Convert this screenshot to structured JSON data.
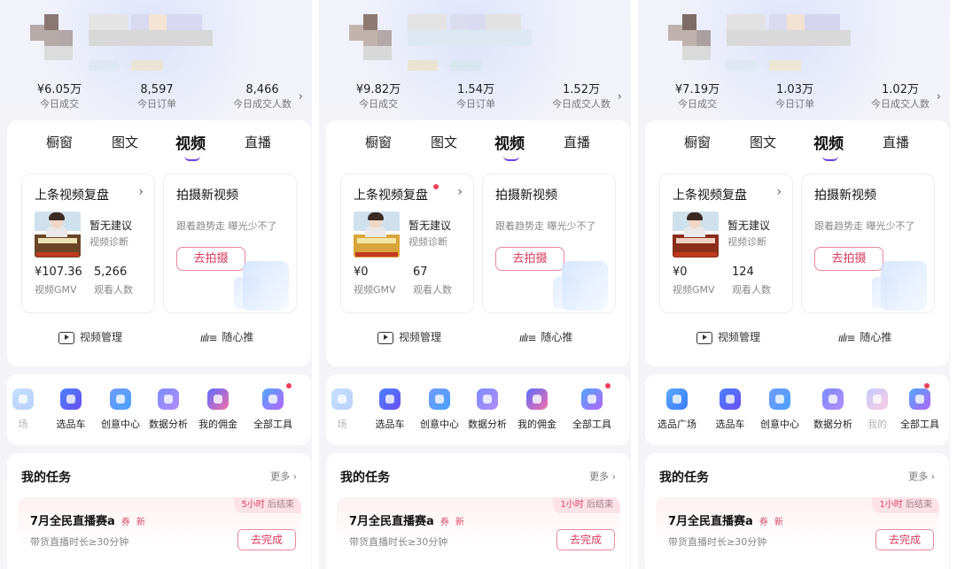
{
  "colors": {
    "accent": "#6b3fe0",
    "brand_red": "#d93a5c",
    "dot": "#f2405d"
  },
  "panels": [
    {
      "stats": [
        {
          "value": "¥6.05万",
          "label": "今日成交"
        },
        {
          "value": "8,597",
          "label": "今日订单"
        },
        {
          "value": "8,466",
          "label": "今日成交人数"
        }
      ],
      "tabs": [
        "橱窗",
        "图文",
        "视频",
        "直播"
      ],
      "active_tab": "视频",
      "review": {
        "title": "上条视频复盘",
        "has_dot": false,
        "suggest": "暂无建议",
        "diagnose": "视频诊断",
        "gmv_value": "¥107.36",
        "gmv_label": "视频GMV",
        "viewers_value": "5,266",
        "viewers_label": "观看人数"
      },
      "shoot": {
        "title": "拍摄新视频",
        "desc": "跟着趋势走 曝光少不了",
        "button": "去拍摄"
      },
      "footer": {
        "manage": "视频管理",
        "recommend": "随心推"
      },
      "tools": [
        "场",
        "选品车",
        "创意中心",
        "数据分析",
        "我的佣金",
        "全部工具"
      ],
      "task": {
        "title": "我的任务",
        "more": "更多",
        "name": "7月全民直播赛a",
        "tag1": "券",
        "tag2": "新",
        "remaining": "5小时",
        "ends": "后结束",
        "requirement": "带货直播时长≥30分钟",
        "button": "去完成"
      }
    },
    {
      "stats": [
        {
          "value": "¥9.82万",
          "label": "今日成交"
        },
        {
          "value": "1.54万",
          "label": "今日订单"
        },
        {
          "value": "1.52万",
          "label": "今日成交人数"
        }
      ],
      "tabs": [
        "橱窗",
        "图文",
        "视频",
        "直播"
      ],
      "active_tab": "视频",
      "review": {
        "title": "上条视频复盘",
        "has_dot": true,
        "suggest": "暂无建议",
        "diagnose": "视频诊断",
        "gmv_value": "¥0",
        "gmv_label": "视频GMV",
        "viewers_value": "67",
        "viewers_label": "观看人数"
      },
      "shoot": {
        "title": "拍摄新视频",
        "desc": "跟着趋势走 曝光少不了",
        "button": "去拍摄"
      },
      "footer": {
        "manage": "视频管理",
        "recommend": "随心推"
      },
      "tools": [
        "场",
        "选品车",
        "创意中心",
        "数据分析",
        "我的佣金",
        "全部工具"
      ],
      "task": {
        "title": "我的任务",
        "more": "更多",
        "name": "7月全民直播赛a",
        "tag1": "券",
        "tag2": "新",
        "remaining": "1小时",
        "ends": "后结束",
        "requirement": "带货直播时长≥30分钟",
        "button": "去完成"
      }
    },
    {
      "stats": [
        {
          "value": "¥7.19万",
          "label": "今日成交"
        },
        {
          "value": "1.03万",
          "label": "今日订单"
        },
        {
          "value": "1.02万",
          "label": "今日成交人数"
        }
      ],
      "tabs": [
        "橱窗",
        "图文",
        "视频",
        "直播"
      ],
      "active_tab": "视频",
      "review": {
        "title": "上条视频复盘",
        "has_dot": false,
        "suggest": "暂无建议",
        "diagnose": "视频诊断",
        "gmv_value": "¥0",
        "gmv_label": "视频GMV",
        "viewers_value": "124",
        "viewers_label": "观看人数"
      },
      "shoot": {
        "title": "拍摄新视频",
        "desc": "跟着趋势走 曝光少不了",
        "button": "去拍摄"
      },
      "footer": {
        "manage": "视频管理",
        "recommend": "随心推"
      },
      "tools": [
        "选品广场",
        "选品车",
        "创意中心",
        "数据分析",
        "我的",
        "全部工具"
      ],
      "task": {
        "title": "我的任务",
        "more": "更多",
        "name": "7月全民直播赛a",
        "tag1": "券",
        "tag2": "新",
        "remaining": "1小时",
        "ends": "后结束",
        "requirement": "带货直播时长≥30分钟",
        "button": "去完成"
      }
    }
  ]
}
